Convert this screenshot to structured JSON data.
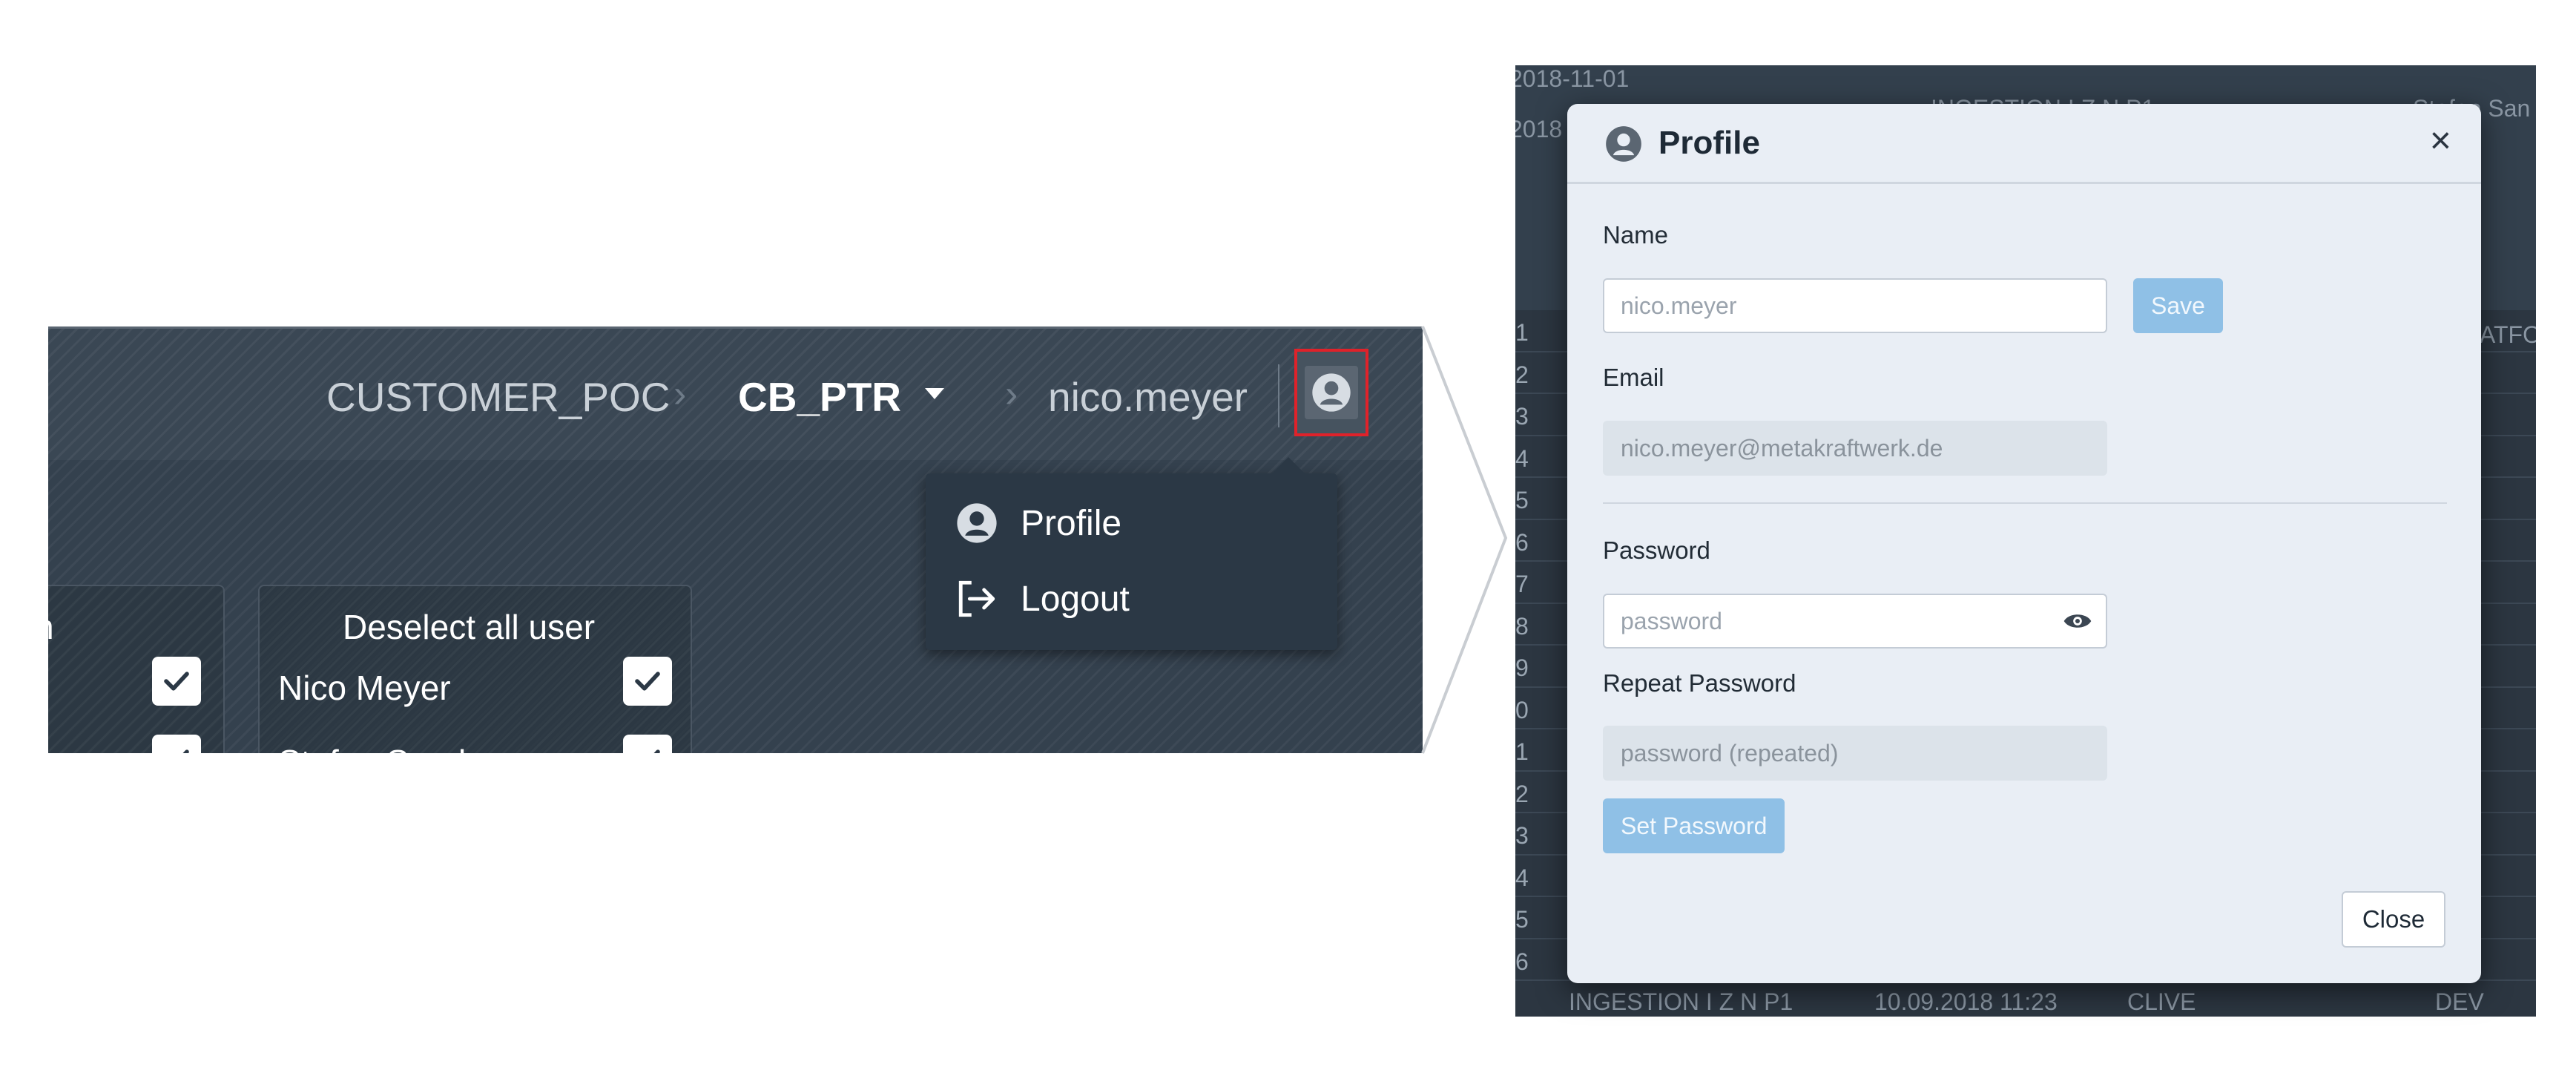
{
  "header": {
    "breadcrumb": [
      "CUSTOMER_POC",
      "CB_PTR",
      "nico.meyer"
    ],
    "user_icon": "user-circle-icon"
  },
  "dropdown": {
    "items": [
      {
        "label": "Profile",
        "icon": "user-circle-icon"
      },
      {
        "label": "Logout",
        "icon": "logout-icon"
      }
    ]
  },
  "cards": {
    "left_partial_title": "n",
    "deselect_title": "Deselect all user",
    "users": [
      "Nico Meyer",
      "Stefan Sander"
    ]
  },
  "background": {
    "dates": [
      "2018-11-01",
      "2018"
    ],
    "header_partial": [
      "INGESTION I Z N P1",
      "Stefan San",
      "ATFO"
    ],
    "row_numbers": [
      "1",
      "2",
      "3",
      "4",
      "5",
      "6",
      "7",
      "8",
      "9",
      "0",
      "1",
      "2",
      "3",
      "4",
      "5",
      "6"
    ],
    "last_row": [
      "INGESTION I Z N P1",
      "10.09.2018 11:23",
      "CLIVE",
      "DEV"
    ]
  },
  "modal": {
    "title": "Profile",
    "close_symbol": "×",
    "name_label": "Name",
    "name_placeholder": "nico.meyer",
    "save_label": "Save",
    "email_label": "Email",
    "email_placeholder": "nico.meyer@metakraftwerk.de",
    "password_label": "Password",
    "password_placeholder": "password",
    "repeat_label": "Repeat Password",
    "repeat_placeholder": "password (repeated)",
    "set_password_label": "Set Password",
    "close_label": "Close"
  },
  "colors": {
    "highlight": "#e0222a",
    "primary_disabled": "#8fc0e6",
    "dark_bg": "#34414e"
  }
}
